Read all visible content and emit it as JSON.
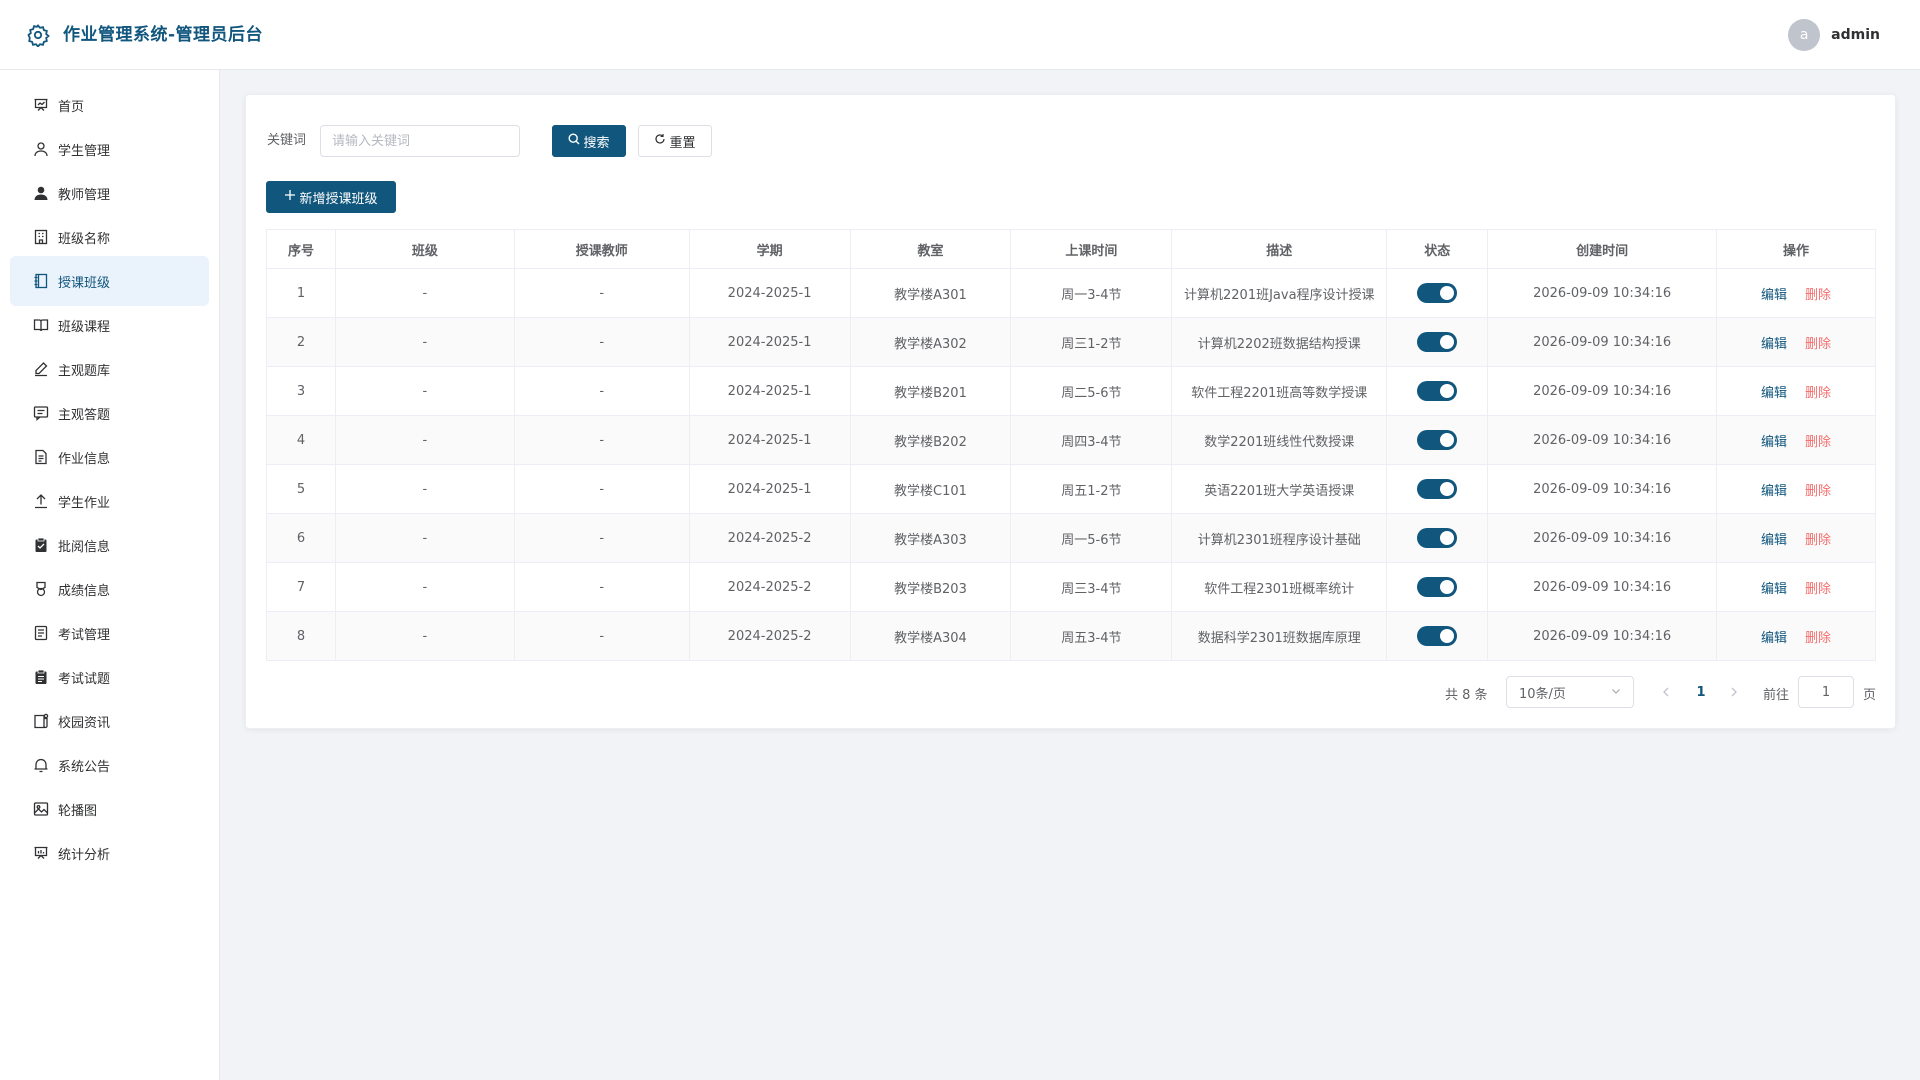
{
  "header": {
    "title": "作业管理系统-管理员后台",
    "avatar_letter": "a",
    "username": "admin"
  },
  "sidebar": {
    "items": [
      {
        "label": "首页",
        "icon": "chart-board-icon"
      },
      {
        "label": "学生管理",
        "icon": "user-outline-icon"
      },
      {
        "label": "教师管理",
        "icon": "user-filled-icon"
      },
      {
        "label": "班级名称",
        "icon": "building-icon"
      },
      {
        "label": "授课班级",
        "icon": "notebook-icon",
        "active": true
      },
      {
        "label": "班级课程",
        "icon": "book-open-icon"
      },
      {
        "label": "主观题库",
        "icon": "edit-pen-icon"
      },
      {
        "label": "主观答题",
        "icon": "message-box-icon"
      },
      {
        "label": "作业信息",
        "icon": "document-icon"
      },
      {
        "label": "学生作业",
        "icon": "upload-icon"
      },
      {
        "label": "批阅信息",
        "icon": "checked-clipboard-icon"
      },
      {
        "label": "成绩信息",
        "icon": "medal-icon"
      },
      {
        "label": "考试管理",
        "icon": "tickets-icon"
      },
      {
        "label": "考试试题",
        "icon": "list-clipboard-icon"
      },
      {
        "label": "校园资讯",
        "icon": "news-icon"
      },
      {
        "label": "系统公告",
        "icon": "bell-icon"
      },
      {
        "label": "轮播图",
        "icon": "picture-icon"
      },
      {
        "label": "统计分析",
        "icon": "data-board-icon"
      }
    ]
  },
  "search": {
    "label": "关键词",
    "placeholder": "请输入关键词",
    "search_button": "搜索",
    "reset_button": "重置",
    "add_button": "新增授课班级"
  },
  "table": {
    "columns": [
      "序号",
      "班级",
      "授课教师",
      "学期",
      "教室",
      "上课时间",
      "描述",
      "状态",
      "创建时间",
      "操作"
    ],
    "edit_label": "编辑",
    "delete_label": "删除",
    "rows": [
      {
        "no": "1",
        "class": "-",
        "teacher": "-",
        "term": "2024-2025-1",
        "room": "教学楼A301",
        "time": "周一3-4节",
        "desc": "计算机2201班Java程序设计授课",
        "status": true,
        "created": "2026-09-09 10:34:16"
      },
      {
        "no": "2",
        "class": "-",
        "teacher": "-",
        "term": "2024-2025-1",
        "room": "教学楼A302",
        "time": "周三1-2节",
        "desc": "计算机2202班数据结构授课",
        "status": true,
        "created": "2026-09-09 10:34:16"
      },
      {
        "no": "3",
        "class": "-",
        "teacher": "-",
        "term": "2024-2025-1",
        "room": "教学楼B201",
        "time": "周二5-6节",
        "desc": "软件工程2201班高等数学授课",
        "status": true,
        "created": "2026-09-09 10:34:16"
      },
      {
        "no": "4",
        "class": "-",
        "teacher": "-",
        "term": "2024-2025-1",
        "room": "教学楼B202",
        "time": "周四3-4节",
        "desc": "数学2201班线性代数授课",
        "status": true,
        "created": "2026-09-09 10:34:16"
      },
      {
        "no": "5",
        "class": "-",
        "teacher": "-",
        "term": "2024-2025-1",
        "room": "教学楼C101",
        "time": "周五1-2节",
        "desc": "英语2201班大学英语授课",
        "status": true,
        "created": "2026-09-09 10:34:16"
      },
      {
        "no": "6",
        "class": "-",
        "teacher": "-",
        "term": "2024-2025-2",
        "room": "教学楼A303",
        "time": "周一5-6节",
        "desc": "计算机2301班程序设计基础",
        "status": true,
        "created": "2026-09-09 10:34:16"
      },
      {
        "no": "7",
        "class": "-",
        "teacher": "-",
        "term": "2024-2025-2",
        "room": "教学楼B203",
        "time": "周三3-4节",
        "desc": "软件工程2301班概率统计",
        "status": true,
        "created": "2026-09-09 10:34:16"
      },
      {
        "no": "8",
        "class": "-",
        "teacher": "-",
        "term": "2024-2025-2",
        "room": "教学楼A304",
        "time": "周五3-4节",
        "desc": "数据科学2301班数据库原理",
        "status": true,
        "created": "2026-09-09 10:34:16"
      }
    ]
  },
  "pagination": {
    "total": "共 8 条",
    "page_size": "10条/页",
    "current_page": "1",
    "goto_label": "前往",
    "goto_value": "1",
    "page_unit": "页"
  },
  "colors": {
    "primary": "#10567d",
    "danger": "#f56c6c",
    "active_bg": "#eaf2fb"
  }
}
